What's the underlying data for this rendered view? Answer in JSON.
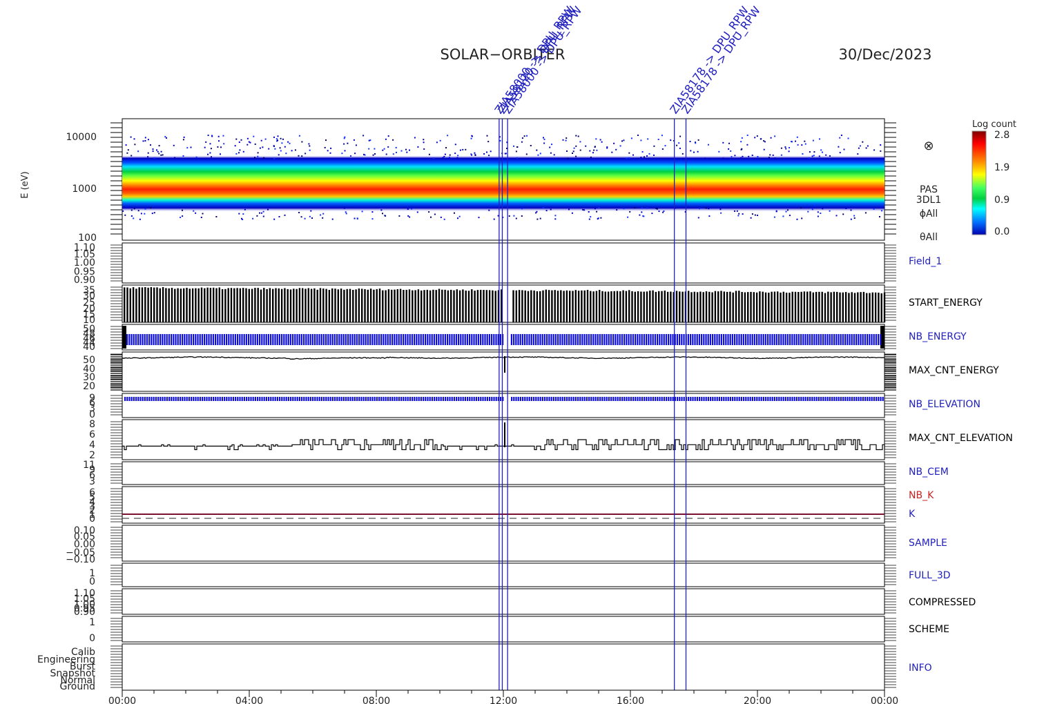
{
  "header": {
    "title": "SOLAR−ORBITER",
    "date": "30/Dec/2023"
  },
  "event_markers": [
    {
      "time": "11:52",
      "label": "ZIA58000 -> DPU_RPW"
    },
    {
      "time": "11:58",
      "label": "ZIA58120 -> DPU_RPW"
    },
    {
      "time": "12:08",
      "label": "ZIA58000 -> DPU_RPW"
    },
    {
      "time": "17:23",
      "label": "ZIA58178 -> DPU_RPW"
    },
    {
      "time": "17:45",
      "label": "ZIA58178 -> DPU_RPW"
    }
  ],
  "colorbar": {
    "title": "Log count",
    "ticks": [
      "2.8",
      "1.9",
      "0.9",
      "0.0"
    ],
    "colors": [
      "#7f0000",
      "#ff0000",
      "#ff8000",
      "#ffff00",
      "#80ff40",
      "#00c000",
      "#00ffff",
      "#0080ff",
      "#0000c0"
    ]
  },
  "chart_data": [
    {
      "type": "heatmap",
      "panel": "spectrogram",
      "ylabel": "E (eV)",
      "yscale": "log",
      "ylim": [
        100,
        16000
      ],
      "yticks": [
        "10000",
        "1000",
        "100"
      ],
      "side_labels": [
        "PAS",
        "3DL1",
        "ϕAll",
        "θAll"
      ],
      "symbol": "⊗",
      "description_bands": [
        {
          "energy_range": [
            600,
            2800
          ],
          "level": "high"
        },
        {
          "energy_range": [
            400,
            4000
          ],
          "level": "medium"
        }
      ]
    },
    {
      "type": "line",
      "name": "Field_1",
      "name_color": "#2020c0",
      "yticks": [
        "1.10",
        "1.05",
        "1.00",
        "0.95",
        "0.90"
      ]
    },
    {
      "type": "bar",
      "name": "START_ENERGY",
      "name_color": "#000000",
      "yticks": [
        "35",
        "30",
        "25",
        "20",
        "15",
        "10"
      ],
      "ylim": [
        5,
        36
      ],
      "typical_range": [
        28,
        34
      ]
    },
    {
      "type": "bar",
      "name": "NB_ENERGY",
      "name_color": "#2020c0",
      "yticks": [
        "50",
        "48",
        "46",
        "44",
        "40"
      ],
      "value": 48
    },
    {
      "type": "line",
      "name": "MAX_CNT_ENERGY",
      "name_color": "#000000",
      "yticks": [
        "50",
        "40",
        "30",
        "20"
      ],
      "ylim": [
        14,
        56
      ],
      "typical_value": 50
    },
    {
      "type": "bar",
      "name": "NB_ELEVATION",
      "name_color": "#2020c0",
      "yticks": [
        "9",
        "6",
        "3",
        "0"
      ],
      "value": 9
    },
    {
      "type": "line",
      "name": "MAX_CNT_ELEVATION",
      "name_color": "#000000",
      "yticks": [
        "8",
        "6",
        "4",
        "2"
      ],
      "ylim": [
        1,
        9
      ],
      "typical_values": [
        3,
        4,
        5
      ]
    },
    {
      "type": "line",
      "name": "NB_CEM",
      "name_color": "#2020c0",
      "yticks": [
        "11",
        "9",
        "6",
        "3"
      ]
    },
    {
      "type": "line",
      "name": "NB_K",
      "name_color": "#cc2020",
      "second_name": "K",
      "second_color": "#2020c0",
      "yticks": [
        "6",
        "5",
        "4",
        "3",
        "2",
        "1",
        "0"
      ],
      "value": 1
    },
    {
      "type": "line",
      "name": "SAMPLE",
      "name_color": "#2020c0",
      "yticks": [
        "0.10",
        "0.05",
        "0.00",
        "−0.05",
        "−0.10"
      ]
    },
    {
      "type": "line",
      "name": "FULL_3D",
      "name_color": "#2020c0",
      "yticks": [
        "1",
        "0"
      ]
    },
    {
      "type": "line",
      "name": "COMPRESSED",
      "name_color": "#000000",
      "yticks": [
        "1.10",
        "1.05",
        "1.00",
        "0.95",
        "0.90"
      ]
    },
    {
      "type": "line",
      "name": "SCHEME",
      "name_color": "#000000",
      "yticks": [
        "1",
        "0"
      ]
    },
    {
      "type": "line",
      "name": "INFO",
      "name_color": "#2020c0",
      "yticks": [
        "Calib",
        "Engineering",
        "Burst",
        "Snapshot",
        "Normal",
        "Ground"
      ]
    }
  ],
  "xaxis": {
    "ticks": [
      "00:00",
      "04:00",
      "08:00",
      "12:00",
      "16:00",
      "20:00",
      "00:00"
    ]
  }
}
